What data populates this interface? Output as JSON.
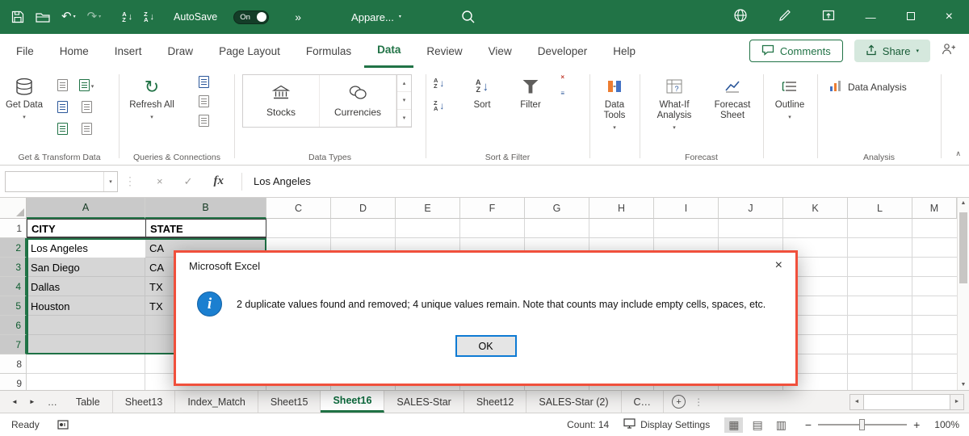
{
  "glyphs": {
    "chevron_down": "▾",
    "chevron_up": "▴",
    "collapse": "∧",
    "double_chevron": "»",
    "undo": "↶",
    "redo": "↷",
    "arrow_down": "↓",
    "refresh": "↻",
    "close": "×",
    "minimize": "—",
    "ellipsis": "…",
    "left_arrow": "◄",
    "right_arrow": "►",
    "up_arrow": "▲",
    "down_arrow": "▼",
    "tri_up": "▴",
    "tri_down": "▾",
    "plus": "+",
    "minus": "−",
    "dots": "⋮",
    "cancel": "×",
    "check": "✓",
    "more": "≡",
    "grid_view": "▦",
    "page_layout_view": "▤",
    "page_break_view": "▥"
  },
  "titlebar": {
    "autosave_label": "AutoSave",
    "autosave_state": "On",
    "workbook_name": "Appare..."
  },
  "ribbon": {
    "tabs": [
      "File",
      "Home",
      "Insert",
      "Draw",
      "Page Layout",
      "Formulas",
      "Data",
      "Review",
      "View",
      "Developer",
      "Help"
    ],
    "comments_label": "Comments",
    "share_label": "Share",
    "get_data": "Get Data",
    "refresh_all": "Refresh All",
    "stocks": "Stocks",
    "currencies": "Currencies",
    "sort": "Sort",
    "filter": "Filter",
    "data_tools": "Data Tools",
    "what_if": "What-If Analysis",
    "forecast_sheet": "Forecast Sheet",
    "outline": "Outline",
    "data_analysis": "Data Analysis",
    "sort_letters": {
      "a": "A",
      "z": "Z"
    },
    "group_labels": {
      "get_transform": "Get & Transform Data",
      "queries": "Queries & Connections",
      "data_types": "Data Types",
      "sort_filter": "Sort & Filter",
      "forecast": "Forecast",
      "analysis": "Analysis"
    }
  },
  "formula_bar": {
    "name_box": "",
    "fx_label": "fx",
    "content": "Los Angeles"
  },
  "sheet": {
    "columns": [
      "A",
      "B",
      "C",
      "D",
      "E",
      "F",
      "G",
      "H",
      "I",
      "J",
      "K",
      "L",
      "M"
    ],
    "rows": [
      "1",
      "2",
      "3",
      "4",
      "5",
      "6",
      "7",
      "8",
      "9"
    ],
    "cells": {
      "A1": "CITY",
      "B1": "STATE",
      "A2": "Los Angeles",
      "B2": "CA",
      "A3": "San Diego",
      "B3": "CA",
      "A4": "Dallas",
      "B4": "TX",
      "A5": "Houston",
      "B5": "TX"
    }
  },
  "dialog": {
    "title": "Microsoft Excel",
    "info_glyph": "i",
    "message": "2 duplicate values found and removed; 4 unique values remain. Note that counts may include empty cells, spaces, etc.",
    "ok_label": "OK"
  },
  "sheet_tabs": {
    "tabs": [
      "Table",
      "Sheet13",
      "Index_Match",
      "Sheet15",
      "Sheet16",
      "SALES-Star",
      "Sheet12",
      "SALES-Star (2)",
      "C…"
    ]
  },
  "status_bar": {
    "ready": "Ready",
    "count": "Count: 14",
    "display_settings": "Display Settings",
    "zoom_level": "100%"
  }
}
